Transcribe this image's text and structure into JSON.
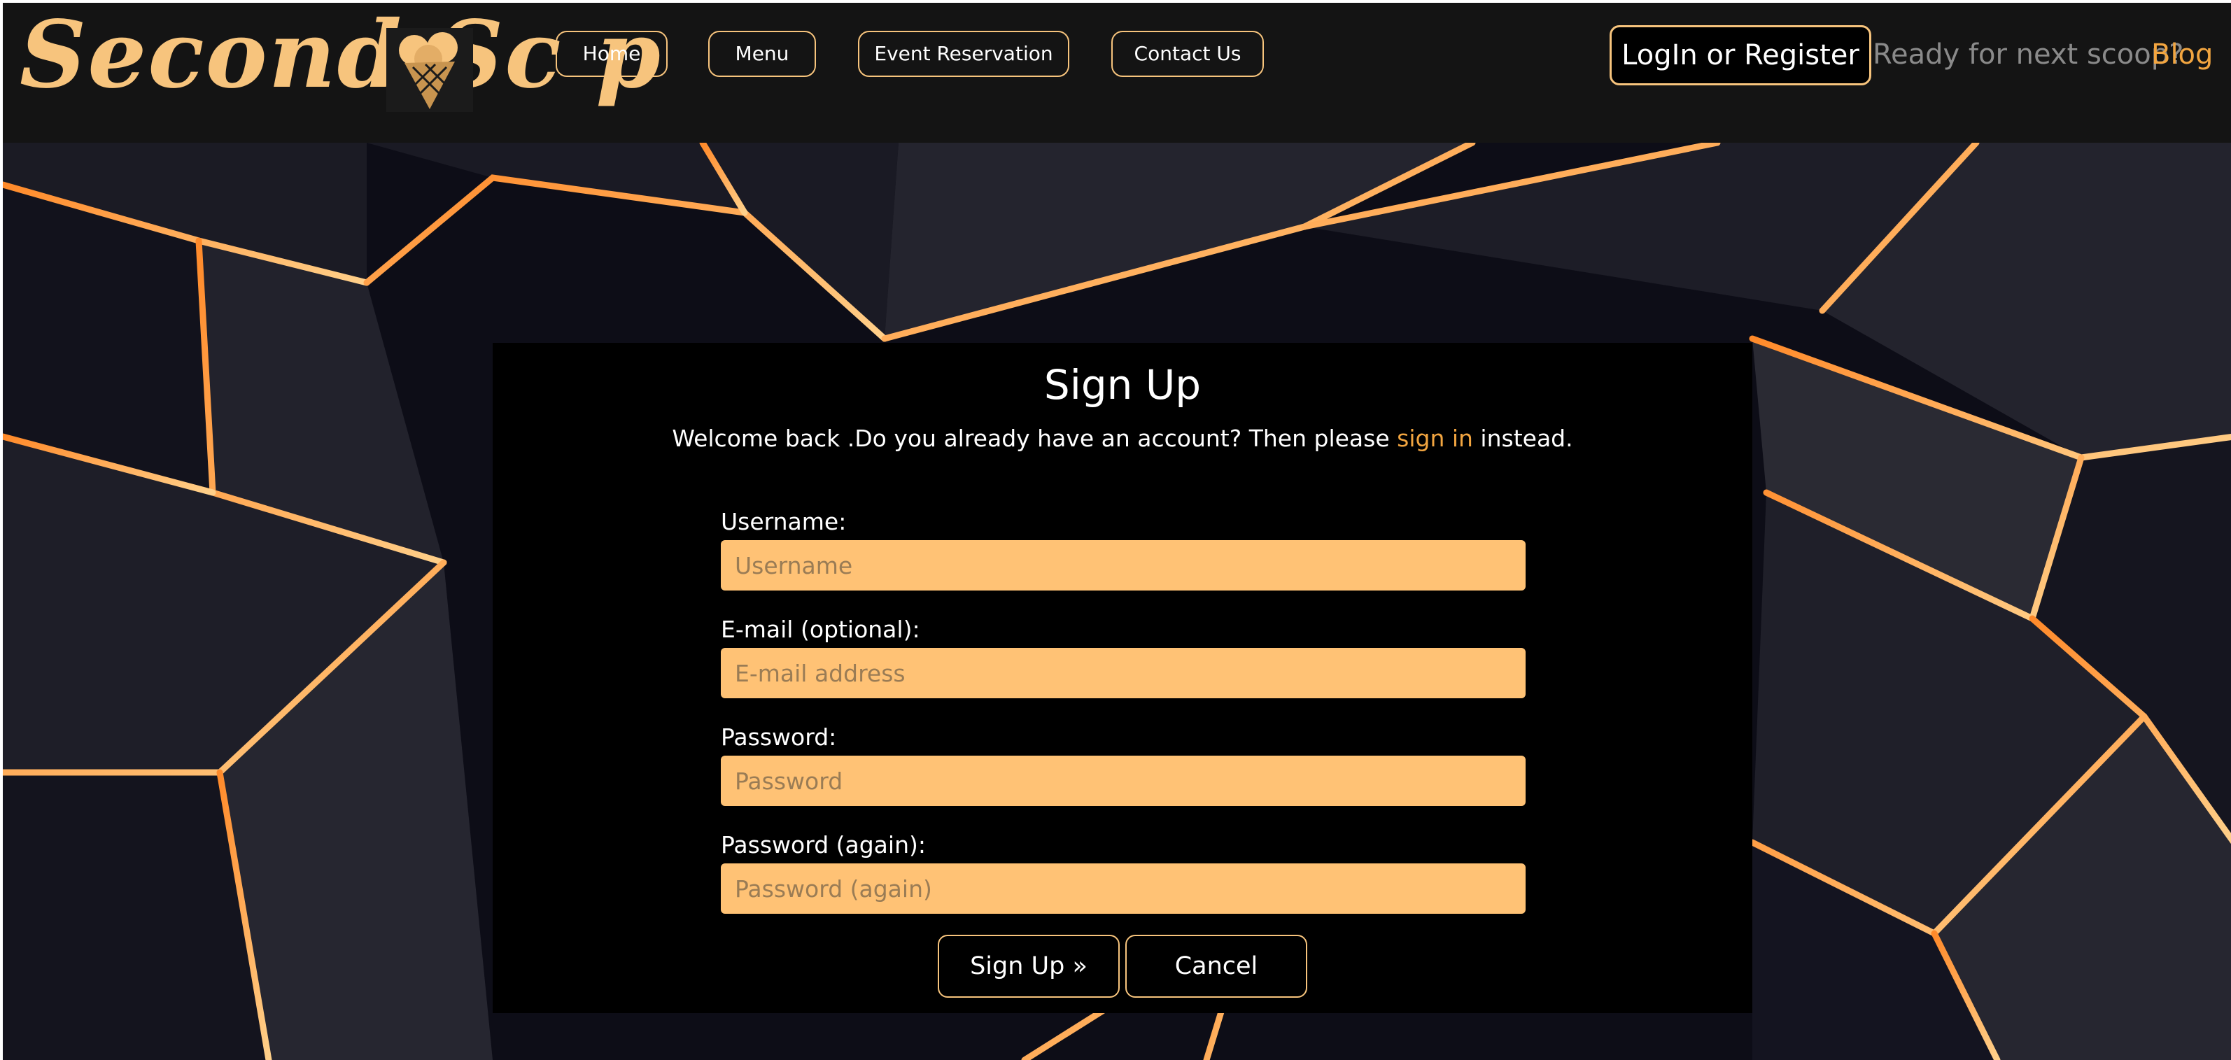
{
  "header": {
    "brand": "Second Sc  p",
    "nav": [
      {
        "label": "Home"
      },
      {
        "label": "Menu"
      },
      {
        "label": "Event Reservation"
      },
      {
        "label": "Contact Us"
      }
    ],
    "login_label": "LogIn or Register",
    "tagline": "Ready for next scoop?",
    "blog_label": "Blog"
  },
  "signup": {
    "title": "Sign Up",
    "subtitle_pre": "Welcome back .Do you already have an account? Then please ",
    "subtitle_link": "sign in",
    "subtitle_post": " instead.",
    "fields": [
      {
        "label": "Username:",
        "placeholder": "Username",
        "value": ""
      },
      {
        "label": "E-mail (optional):",
        "placeholder": "E-mail address",
        "value": ""
      },
      {
        "label": "Password:",
        "placeholder": "Password",
        "value": ""
      },
      {
        "label": "Password (again):",
        "placeholder": "Password (again)",
        "value": ""
      }
    ],
    "submit_label": "Sign Up »",
    "cancel_label": "Cancel"
  },
  "colors": {
    "accent": "#f7c47d",
    "link": "#f2a540",
    "input_bg": "#ffc275",
    "header_bg": "#141414",
    "panel_bg": "#000000"
  },
  "icons": {
    "brand_cone": "ice-cream-cone-icon"
  }
}
